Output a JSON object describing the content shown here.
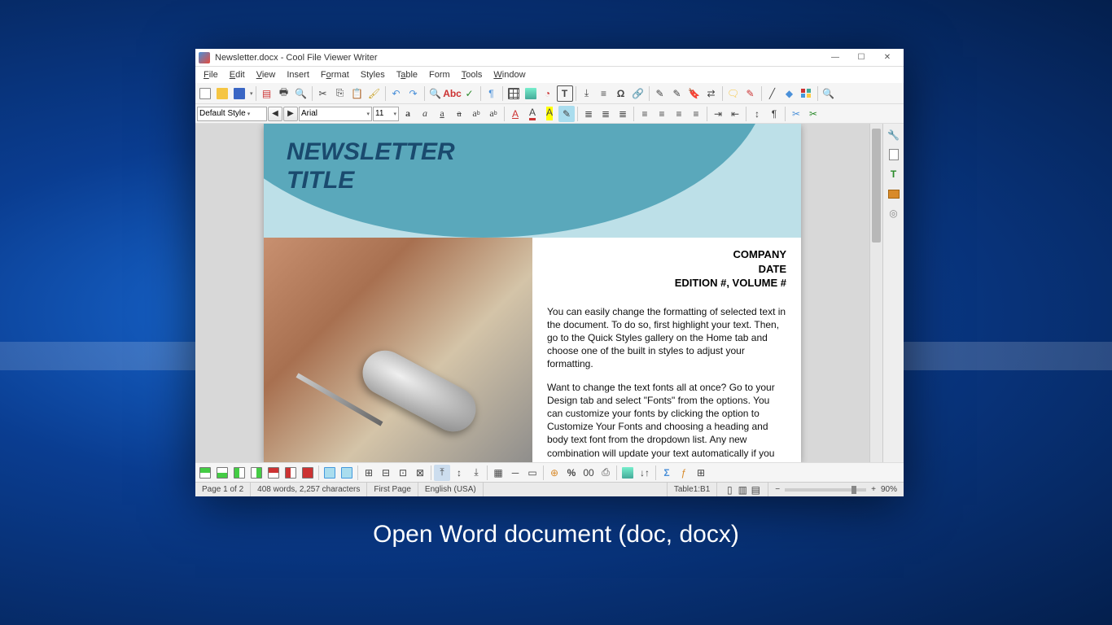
{
  "marketing_caption": "Open Word document (doc, docx)",
  "window": {
    "title": "Newsletter.docx - Cool File Viewer Writer",
    "minimize": "—",
    "maximize": "☐",
    "close": "✕"
  },
  "menus": {
    "file": "File",
    "edit": "Edit",
    "view": "View",
    "insert": "Insert",
    "format": "Format",
    "styles": "Styles",
    "table": "Table",
    "form": "Form",
    "tools": "Tools",
    "window": "Window"
  },
  "formatbar": {
    "style": "Default Style",
    "font": "Arial",
    "size": "11"
  },
  "document": {
    "title_line1": "NEWSLETTER",
    "title_line2": "TITLE",
    "meta_company": "COMPANY",
    "meta_date": "DATE",
    "meta_edition": "EDITION #, VOLUME #",
    "para1": "You can easily change the formatting of selected text in the document.  To do so, first highlight your text.  Then, go to the Quick Styles gallery on the Home tab and choose one of the built in styles to adjust your formatting.",
    "para2": "Want to change the text fonts all at once? Go to your Design tab and select \"Fonts\" from the options.  You can customize your fonts by clicking the option to Customize Your Fonts and choosing a heading and body text font from the dropdown list.  Any new combination will update your text automatically if you stick with using styles throughout."
  },
  "status": {
    "page": "Page 1 of 2",
    "words": "408 words, 2,257 characters",
    "pagestyle": "First Page",
    "lang": "English (USA)",
    "table": "Table1:B1",
    "zoom": "90%"
  }
}
